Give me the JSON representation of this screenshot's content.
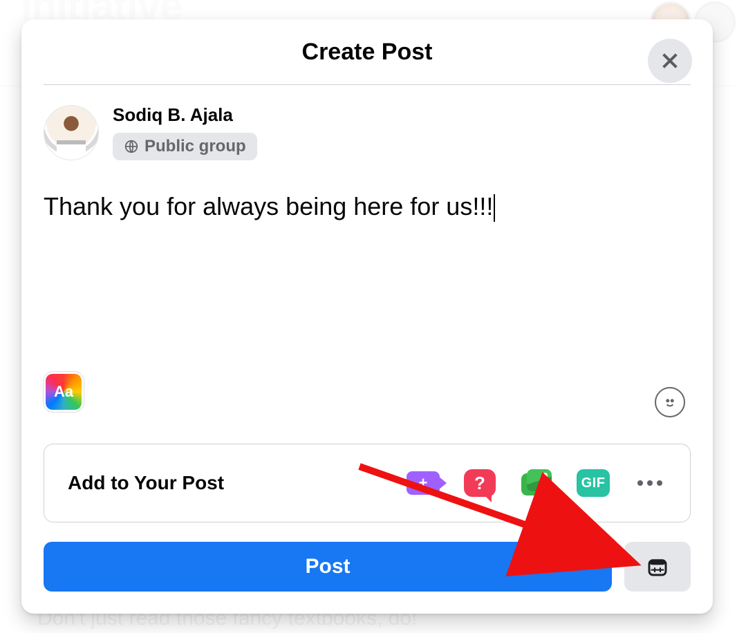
{
  "background": {
    "title_fragment": "Initiative",
    "bottom_text_fragment": "Don't just read those fancy textbooks, do!"
  },
  "modal": {
    "title": "Create Post",
    "user": {
      "name": "Sodiq B. Ajala",
      "audience_label": "Public group"
    },
    "compose_text": "Thank you for always being here for us!!!",
    "bg_picker_label": "Aa",
    "add_to_post_label": "Add to Your Post",
    "gif_label": "GIF",
    "post_button_label": "Post"
  }
}
